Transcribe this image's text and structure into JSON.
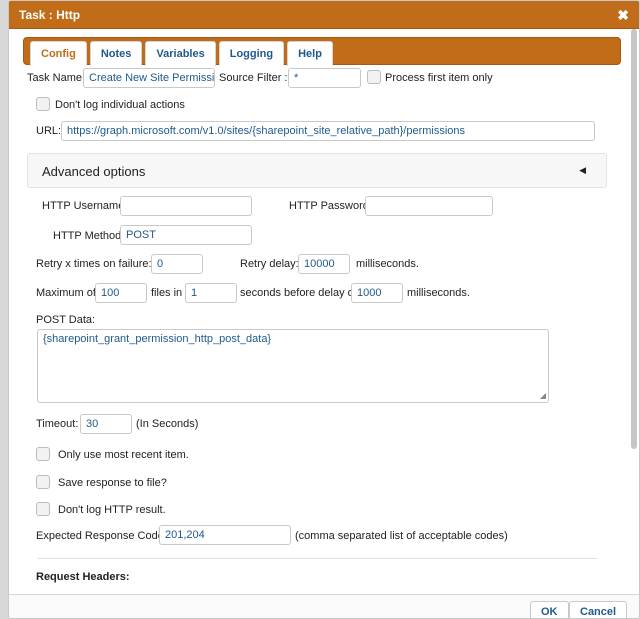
{
  "dialog": {
    "title": "Task : Http",
    "close_glyph": "✖"
  },
  "tabs": [
    {
      "label": "Config",
      "active": true
    },
    {
      "label": "Notes"
    },
    {
      "label": "Variables"
    },
    {
      "label": "Logging"
    },
    {
      "label": "Help"
    }
  ],
  "config": {
    "task_name_label": "Task Name:",
    "task_name_value": "Create New Site Permissic",
    "source_filter_label": "Source Filter :",
    "source_filter_value": "*",
    "process_first_label": "Process first item only",
    "dont_log_label": "Don't log individual actions",
    "url_label": "URL:",
    "url_value": "https://graph.microsoft.com/v1.0/sites/{sharepoint_site_relative_path}/permissions"
  },
  "advanced": {
    "title": "Advanced options",
    "arrow_glyph": "◀",
    "http_username_label": "HTTP Username:",
    "http_username_value": "",
    "http_password_label": "HTTP Password:",
    "http_password_value": "",
    "http_method_label": "HTTP Method:",
    "http_method_value": "POST",
    "retry_label": "Retry x times on failure:",
    "retry_value": "0",
    "retry_delay_label": "Retry delay:",
    "retry_delay_value": "10000",
    "retry_delay_unit": "milliseconds.",
    "max_label": "Maximum of",
    "max_files_value": "100",
    "files_in_label": "files in",
    "seconds_value": "1",
    "seconds_before_label": "seconds before delay of",
    "delay_value": "1000",
    "delay_unit": "milliseconds.",
    "post_data_label": "POST Data:",
    "post_data_value": "{sharepoint_grant_permission_http_post_data}",
    "timeout_label": "Timeout:",
    "timeout_value": "30",
    "timeout_unit": "(In Seconds)",
    "only_recent_label": "Only use most recent item.",
    "save_response_label": "Save response to file?",
    "dont_log_http_label": "Don't log HTTP result.",
    "expected_codes_label": "Expected Response Codes:",
    "expected_codes_value": "201,204",
    "expected_codes_hint": "(comma separated list of acceptable codes)",
    "request_headers_label": "Request Headers:"
  },
  "footer": {
    "ok_label": "OK",
    "cancel_label": "Cancel"
  },
  "colors": {
    "accent": "#c06c18",
    "link": "#1f5a8c"
  }
}
